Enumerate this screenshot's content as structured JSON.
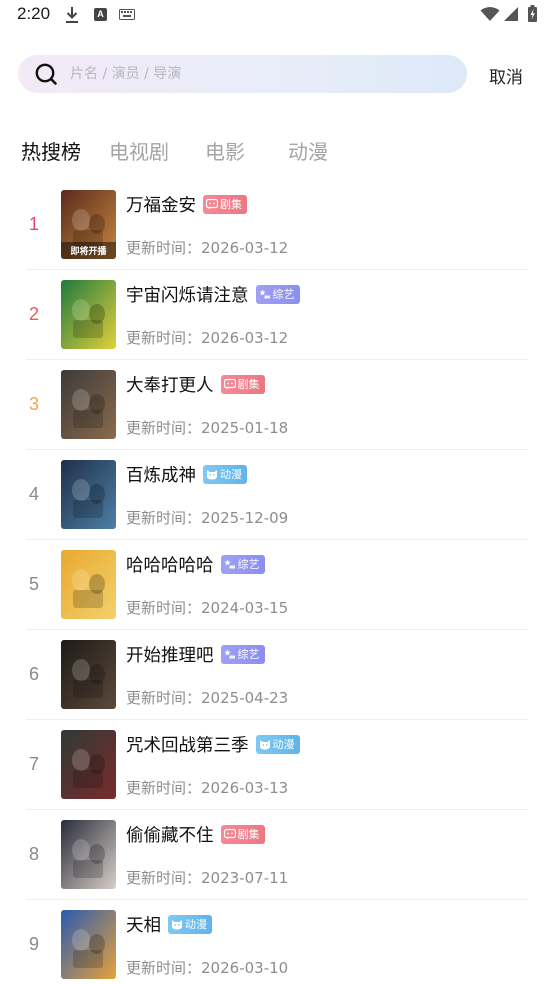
{
  "status_bar": {
    "time": "2:20"
  },
  "search": {
    "placeholder": "片名 / 演员 / 导演",
    "value": "",
    "cancel_label": "取消"
  },
  "tabs": [
    {
      "label": "热搜榜",
      "active": true
    },
    {
      "label": "电视剧",
      "active": false
    },
    {
      "label": "电影",
      "active": false
    },
    {
      "label": "动漫",
      "active": false
    }
  ],
  "badge_types": {
    "drama": {
      "label": "剧集",
      "color": "#f07d89"
    },
    "variety": {
      "label": "综艺",
      "color": "#9396f1"
    },
    "anime": {
      "label": "动漫",
      "color": "#69baee"
    }
  },
  "rank_colors": {
    "1": "#e8437a",
    "2": "#ec5a4f",
    "3": "#f3a745",
    "default": "#8a8a8a"
  },
  "update_prefix": "更新时间：",
  "items": [
    {
      "rank": "1",
      "title": "万福金安",
      "badge": "剧集",
      "type": "drama",
      "date": "2026-03-12",
      "poster_colors": [
        "#5a2b1e",
        "#c7863e"
      ],
      "poster_text": "即将开播"
    },
    {
      "rank": "2",
      "title": "宇宙闪烁请注意",
      "badge": "综艺",
      "type": "variety",
      "date": "2026-03-12",
      "poster_colors": [
        "#1f7a3e",
        "#e2d03a"
      ],
      "poster_text": ""
    },
    {
      "rank": "3",
      "title": "大奉打更人",
      "badge": "剧集",
      "type": "drama",
      "date": "2025-01-18",
      "poster_colors": [
        "#3c3a3a",
        "#8b6b4c"
      ],
      "poster_text": ""
    },
    {
      "rank": "4",
      "title": "百炼成神",
      "badge": "动漫",
      "type": "anime",
      "date": "2025-12-09",
      "poster_colors": [
        "#20304a",
        "#4d7fa6"
      ],
      "poster_text": ""
    },
    {
      "rank": "5",
      "title": "哈哈哈哈哈",
      "badge": "综艺",
      "type": "variety",
      "date": "2024-03-15",
      "poster_colors": [
        "#e9a92f",
        "#f2d06b"
      ],
      "poster_text": ""
    },
    {
      "rank": "6",
      "title": "开始推理吧",
      "badge": "综艺",
      "type": "variety",
      "date": "2025-04-23",
      "poster_colors": [
        "#1e1a17",
        "#5b4a3b"
      ],
      "poster_text": ""
    },
    {
      "rank": "7",
      "title": "咒术回战第三季",
      "badge": "动漫",
      "type": "anime",
      "date": "2026-03-13",
      "poster_colors": [
        "#2f3a36",
        "#7a2b2b"
      ],
      "poster_text": ""
    },
    {
      "rank": "8",
      "title": "偷偷藏不住",
      "badge": "剧集",
      "type": "drama",
      "date": "2023-07-11",
      "poster_colors": [
        "#2a2c3a",
        "#d8cfc8"
      ],
      "poster_text": ""
    },
    {
      "rank": "9",
      "title": "天相",
      "badge": "动漫",
      "type": "anime",
      "date": "2026-03-10",
      "poster_colors": [
        "#2a5bb0",
        "#e6a23a"
      ],
      "poster_text": ""
    }
  ]
}
